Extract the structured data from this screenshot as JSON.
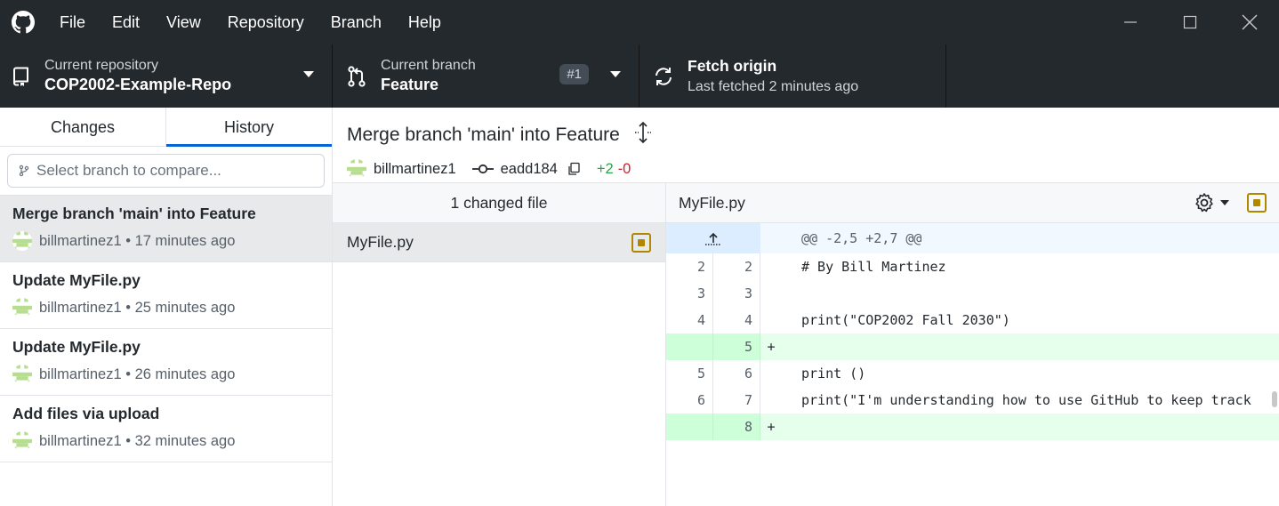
{
  "app": {
    "menu": [
      "File",
      "Edit",
      "View",
      "Repository",
      "Branch",
      "Help"
    ]
  },
  "toolbar": {
    "repo_label": "Current repository",
    "repo_name": "COP2002-Example-Repo",
    "branch_label": "Current branch",
    "branch_name": "Feature",
    "pr_badge": "#1",
    "fetch_title": "Fetch origin",
    "fetch_status": "Last fetched 2 minutes ago"
  },
  "sidebar": {
    "tabs": [
      "Changes",
      "History"
    ],
    "active_tab": "History",
    "filter_placeholder": "Select branch to compare...",
    "commits": [
      {
        "title": "Merge branch 'main' into Feature",
        "author": "billmartinez1",
        "time": "• 17 minutes ago",
        "selected": true
      },
      {
        "title": "Update MyFile.py",
        "author": "billmartinez1",
        "time": "• 25 minutes ago",
        "selected": false
      },
      {
        "title": "Update MyFile.py",
        "author": "billmartinez1",
        "time": "• 26 minutes ago",
        "selected": false
      },
      {
        "title": "Add files via upload",
        "author": "billmartinez1",
        "time": "• 32 minutes ago",
        "selected": false
      }
    ]
  },
  "commit": {
    "summary": "Merge branch 'main' into Feature",
    "author": "billmartinez1",
    "sha": "eadd184",
    "additions": "+2",
    "deletions": "-0"
  },
  "files": {
    "header": "1 changed file",
    "items": [
      {
        "name": "MyFile.py",
        "status": "modified"
      }
    ]
  },
  "diff": {
    "file_name": "MyFile.py",
    "hunk_header": "@@ -2,5 +2,7 @@",
    "lines": [
      {
        "old": "2",
        "new": "2",
        "marker": "",
        "code": "# By Bill Martinez",
        "type": "context"
      },
      {
        "old": "3",
        "new": "3",
        "marker": "",
        "code": "",
        "type": "context"
      },
      {
        "old": "4",
        "new": "4",
        "marker": "",
        "code": "print(\"COP2002 Fall 2030\")",
        "type": "context"
      },
      {
        "old": "",
        "new": "5",
        "marker": "+",
        "code": "",
        "type": "add"
      },
      {
        "old": "5",
        "new": "6",
        "marker": "",
        "code": "print ()",
        "type": "context"
      },
      {
        "old": "6",
        "new": "7",
        "marker": "",
        "code": "print(\"I'm understanding how to use GitHub to keep track",
        "type": "context"
      },
      {
        "old": "",
        "new": "8",
        "marker": "+",
        "code": "",
        "type": "add"
      }
    ]
  },
  "colors": {
    "chrome": "#24292e",
    "accent": "#0366d6",
    "added": "#28a745",
    "removed": "#cb2431",
    "modified": "#b08800"
  }
}
